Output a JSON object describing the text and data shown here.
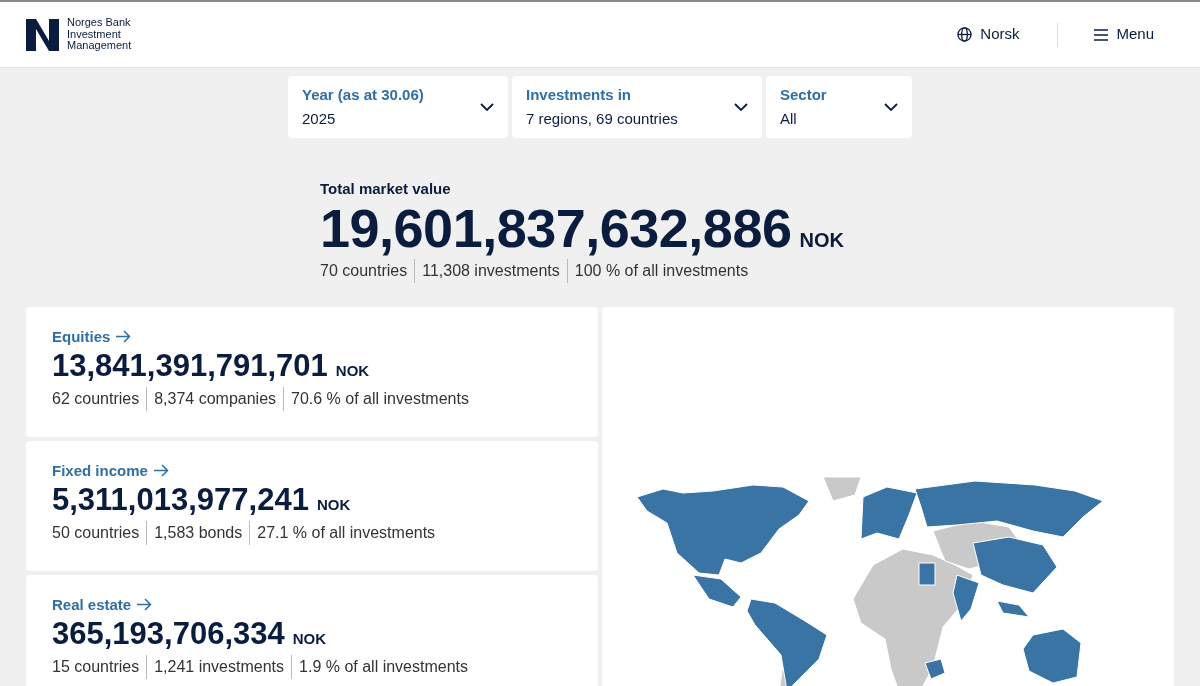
{
  "header": {
    "logo_text": [
      "Norges Bank",
      "Investment",
      "Management"
    ],
    "language": "Norsk",
    "menu": "Menu"
  },
  "filters": [
    {
      "label": "Year (as at 30.06)",
      "value": "2025"
    },
    {
      "label": "Investments in",
      "value": "7 regions, 69 countries"
    },
    {
      "label": "Sector",
      "value": "All"
    }
  ],
  "total": {
    "label": "Total market value",
    "value": "19,601,837,632,886",
    "currency": "NOK",
    "stats": [
      "70 countries",
      "11,308 investments",
      "100 % of all investments"
    ]
  },
  "asset_classes": [
    {
      "title": "Equities",
      "value": "13,841,391,791,701",
      "currency": "NOK",
      "stats": [
        "62 countries",
        "8,374 companies",
        "70.6 % of all investments"
      ]
    },
    {
      "title": "Fixed income",
      "value": "5,311,013,977,241",
      "currency": "NOK",
      "stats": [
        "50 countries",
        "1,583 bonds",
        "27.1 % of all investments"
      ]
    },
    {
      "title": "Real estate",
      "value": "365,193,706,334",
      "currency": "NOK",
      "stats": [
        "15 countries",
        "1,241 investments",
        "1.9 % of all investments"
      ]
    }
  ]
}
